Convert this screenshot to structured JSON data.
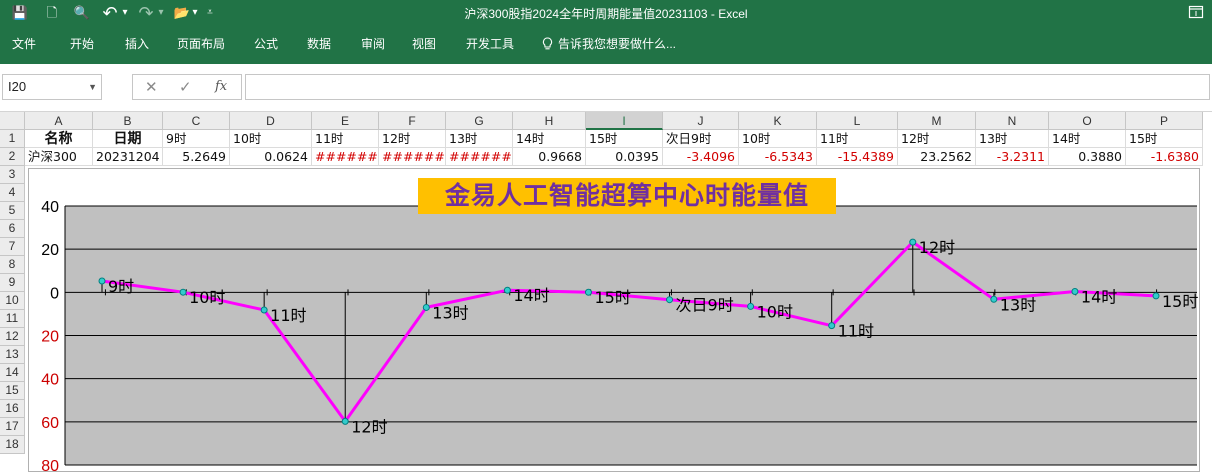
{
  "window": {
    "title": "沪深300股指2024全年时周期能量值20231103 - Excel",
    "restore_icon": "window-restore-icon"
  },
  "quick_access": [
    {
      "name": "save-icon",
      "glyph": "💾"
    },
    {
      "name": "new-file-icon",
      "glyph": "🗋"
    },
    {
      "name": "print-preview-icon",
      "glyph": "🔍"
    },
    {
      "name": "undo-icon",
      "glyph": "↶"
    },
    {
      "name": "undo-dropdown-icon",
      "glyph": "▾"
    },
    {
      "name": "redo-icon",
      "glyph": "↷"
    },
    {
      "name": "redo-dropdown-icon",
      "glyph": "▾"
    },
    {
      "name": "open-folder-icon",
      "glyph": "📂"
    },
    {
      "name": "folder-dropdown-icon",
      "glyph": "▾"
    },
    {
      "name": "customize-toolbar-icon",
      "glyph": "⩡"
    }
  ],
  "ribbon": {
    "tabs": [
      "文件",
      "开始",
      "插入",
      "页面布局",
      "公式",
      "数据",
      "审阅",
      "视图",
      "开发工具"
    ],
    "tell_me": "告诉我您想要做什么...",
    "tell_me_icon": "lightbulb-icon"
  },
  "formula_bar": {
    "name_box": "I20",
    "cancel_icon": "✕",
    "enter_icon": "✓",
    "function_icon": "fx",
    "formula": ""
  },
  "grid": {
    "selected_column": "I",
    "columns": [
      "A",
      "B",
      "C",
      "D",
      "E",
      "F",
      "G",
      "H",
      "I",
      "J",
      "K",
      "L",
      "M",
      "N",
      "O",
      "P"
    ],
    "rows": [
      "1",
      "2",
      "3",
      "4",
      "5",
      "6",
      "7",
      "8",
      "9",
      "10",
      "11",
      "12",
      "13",
      "14",
      "15",
      "16",
      "17",
      "18"
    ],
    "row1": [
      "名称",
      "日期",
      "9时",
      "10时",
      "11时",
      "12时",
      "13时",
      "14时",
      "15时",
      "次日9时",
      "10时",
      "11时",
      "12时",
      "13时",
      "14时",
      "15时"
    ],
    "row2": [
      "沪深300",
      "20231204",
      "5.2649",
      "0.0624",
      "#######",
      "#######",
      "#######",
      "0.9668",
      "0.0395",
      "-3.4096",
      "-6.5343",
      "-15.4389",
      "23.2562",
      "-3.2311",
      "0.3880",
      "-1.6380"
    ]
  },
  "colors": {
    "excel_green": "#217346",
    "line": "#ff00ff",
    "marker": "#33cccc",
    "plot_area": "#c0c0c0",
    "negative_tick": "#cc0000",
    "title_bg": "#ffc000",
    "title_text": "#7030a0"
  },
  "chart_data": {
    "type": "line",
    "title": "金易人工智能超算中心时能量值",
    "categories": [
      "9时",
      "10时",
      "11时",
      "12时",
      "13时",
      "14时",
      "15时",
      "次日9时",
      "10时",
      "11时",
      "12时",
      "13时",
      "14时",
      "15时"
    ],
    "series": [
      {
        "values": [
          5.2649,
          0.0624,
          -8.2,
          -59.8,
          -7.0,
          0.9668,
          0.0395,
          -3.4096,
          -6.5343,
          -15.4389,
          23.2562,
          -3.2311,
          0.388,
          -1.638
        ]
      }
    ],
    "ylim": [
      -80,
      40
    ],
    "yticks": [
      "40",
      "20",
      "0",
      "20",
      "40",
      "60",
      "80"
    ],
    "grid": true,
    "legend": "none"
  }
}
